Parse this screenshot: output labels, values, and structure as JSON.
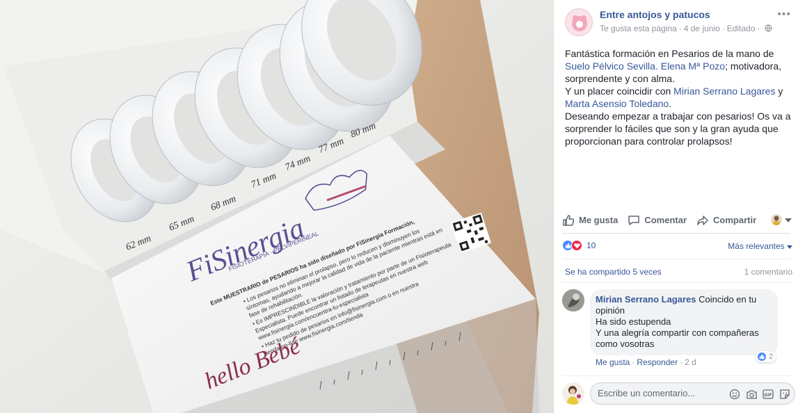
{
  "photo": {
    "sizes": [
      "62 mm",
      "65 mm",
      "68 mm",
      "71 mm",
      "74 mm",
      "77 mm",
      "80 mm"
    ],
    "brand": "FiSinergia",
    "brand_sub": "FISIOTERAPIA · PELVIPERINEAL",
    "card_heading": "Este MUESTRARIO de PESARIOS ha sido diseñado por FiSinergia Formación,",
    "card_lines": [
      "• Los pesarios no eliminan el prolapso, pero lo reducen y disminuyen los",
      "síntomas, ayudando a mejorar la calidad de vida de la paciente mientras está en",
      "fase de rehabilitación.",
      "• Es IMPRESCINDIBLE la valoración y tratamiento por parte de un Fisioterapeuta",
      "Especialista. Puede encontrar un listado de terapeutas en nuestra web",
      "www.fisinergia.com/encuentra-tu-especialista",
      "• Haz tu pedido de pesarios en info@fisinergia.com o en nuestra",
      "tienda on-line www.fisinergia.com/tienda"
    ],
    "logo_bebe": "hello Bebé",
    "accent_purple": "#5b4f93",
    "accent_rose": "#b44a6d"
  },
  "post": {
    "page_name": "Entre antojos y patucos",
    "meta_like": "Te gusta esta página",
    "meta_date": "4 de junio",
    "meta_edited": "Editado",
    "text_1": "Fantástica formación en Pesarios de la mano de ",
    "link_1": "Suelo Pélvico Sevilla. Elena Mª Pozo",
    "text_2": "; motivadora, sorprendente y con alma.",
    "text_3": "Y un placer coincidir con ",
    "link_2": "Mirian Serrano Lagares",
    "text_4": " y ",
    "link_3": "Marta Asensio Toledano",
    "text_5": ".",
    "text_6": "Deseando empezar a trabajar con pesarios! Os va a sorprender lo fáciles que son y la gran ayuda que proporcionan para controlar prolapsos!"
  },
  "actions": {
    "like": "Me gusta",
    "comment": "Comentar",
    "share": "Compartir"
  },
  "stats": {
    "reactions_count": "10",
    "sort_label": "Más relevantes",
    "shares": "Se ha compartido 5 veces",
    "comments": "1 comentario"
  },
  "comment": {
    "author": "Mirian Serrano Lagares",
    "text_1": " Coincido en tu opinión",
    "text_2": "Ha sido estupenda",
    "text_3": "Y una alegría compartir con compañeras como vosotras",
    "likes": "2",
    "like_label": "Me gusta",
    "reply_label": "Responder",
    "time": "2 d"
  },
  "composer": {
    "placeholder": "Escribe un comentario..."
  },
  "colors": {
    "link": "#365899",
    "muted": "#90949c",
    "like_blue": "#4a89ff",
    "love_red": "#f0284a"
  }
}
